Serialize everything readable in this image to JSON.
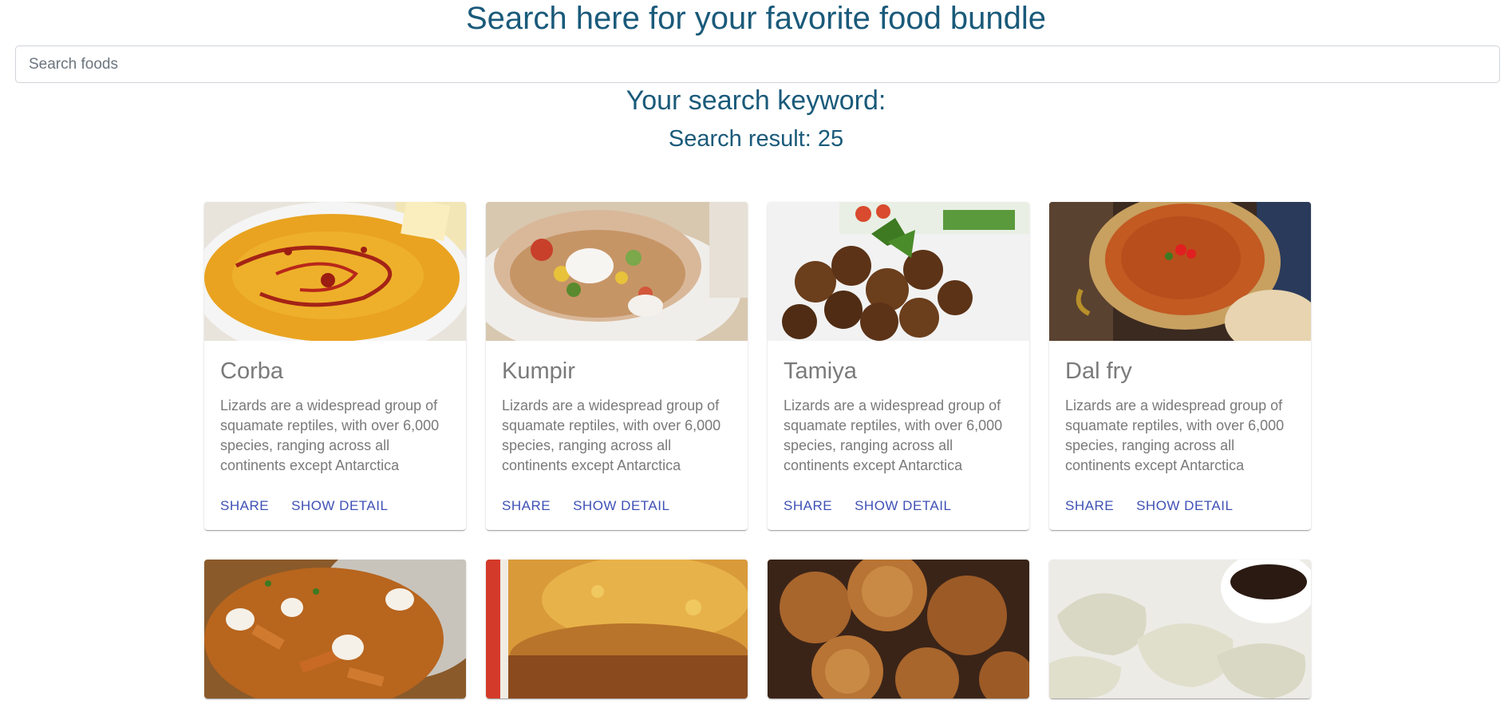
{
  "header": {
    "title": "Search here for your favorite food bundle",
    "search_placeholder": "Search foods",
    "keyword_label": "Your search keyword:",
    "result_label": "Search result: 25"
  },
  "cards": [
    {
      "title": "Corba",
      "description": "Lizards are a widespread group of squamate reptiles, with over 6,000 species, ranging across all continents except Antarctica",
      "share_label": "SHARE",
      "detail_label": "SHOW DETAIL",
      "image": "lentil-soup"
    },
    {
      "title": "Kumpir",
      "description": "Lizards are a widespread group of squamate reptiles, with over 6,000 species, ranging across all continents except Antarctica",
      "share_label": "SHARE",
      "detail_label": "SHOW DETAIL",
      "image": "stuffed-potato"
    },
    {
      "title": "Tamiya",
      "description": "Lizards are a widespread group of squamate reptiles, with over 6,000 species, ranging across all continents except Antarctica",
      "share_label": "SHARE",
      "detail_label": "SHOW DETAIL",
      "image": "falafel"
    },
    {
      "title": "Dal fry",
      "description": "Lizards are a widespread group of squamate reptiles, with over 6,000 species, ranging across all continents except Antarctica",
      "share_label": "SHARE",
      "detail_label": "SHOW DETAIL",
      "image": "dal-curry"
    },
    {
      "title": "",
      "description": "",
      "share_label": "",
      "detail_label": "",
      "image": "poutine"
    },
    {
      "title": "",
      "description": "",
      "share_label": "",
      "detail_label": "",
      "image": "lasagna"
    },
    {
      "title": "",
      "description": "",
      "share_label": "",
      "detail_label": "",
      "image": "fried-dough"
    },
    {
      "title": "",
      "description": "",
      "share_label": "",
      "detail_label": "",
      "image": "dumplings"
    }
  ]
}
